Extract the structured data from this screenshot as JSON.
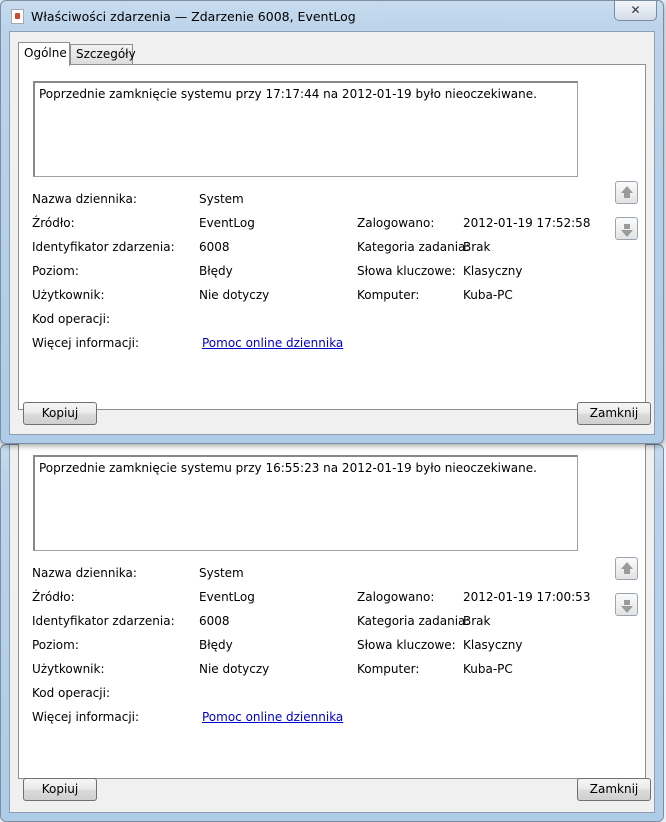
{
  "window": {
    "title": "Właściwości zdarzenia — Zdarzenie 6008, EventLog",
    "close_symbol": "✕"
  },
  "tabs": [
    "Ogólne",
    "Szczegóły"
  ],
  "labels": {
    "log_name": "Nazwa dziennika:",
    "source": "Źródło:",
    "event_id": "Identyfikator zdarzenia:",
    "level": "Poziom:",
    "user": "Użytkownik:",
    "opcode": "Kod operacji:",
    "more_info": "Więcej informacji:",
    "logged": "Zalogowano:",
    "task_category": "Kategoria zadania:",
    "keywords": "Słowa kluczowe:",
    "computer": "Komputer:"
  },
  "buttons": {
    "copy": "Kopiuj",
    "close": "Zamknij"
  },
  "events": [
    {
      "message": "Poprzednie zamknięcie systemu przy 17:17:44 na 2012-01-19 było nieoczekiwane.",
      "log_name": "System",
      "source": "EventLog",
      "event_id": "6008",
      "level": "Błędy",
      "user": "Nie dotyczy",
      "opcode": "",
      "more_info": "Pomoc online dziennika",
      "logged": "2012-01-19 17:52:58",
      "task_category": "Brak",
      "keywords": "Klasyczny",
      "computer": "Kuba-PC"
    },
    {
      "message": "Poprzednie zamknięcie systemu przy 16:55:23 na 2012-01-19 było nieoczekiwane.",
      "log_name": "System",
      "source": "EventLog",
      "event_id": "6008",
      "level": "Błędy",
      "user": "Nie dotyczy",
      "opcode": "",
      "more_info": "Pomoc online dziennika",
      "logged": "2012-01-19 17:00:53",
      "task_category": "Brak",
      "keywords": "Klasyczny",
      "computer": "Kuba-PC"
    }
  ]
}
